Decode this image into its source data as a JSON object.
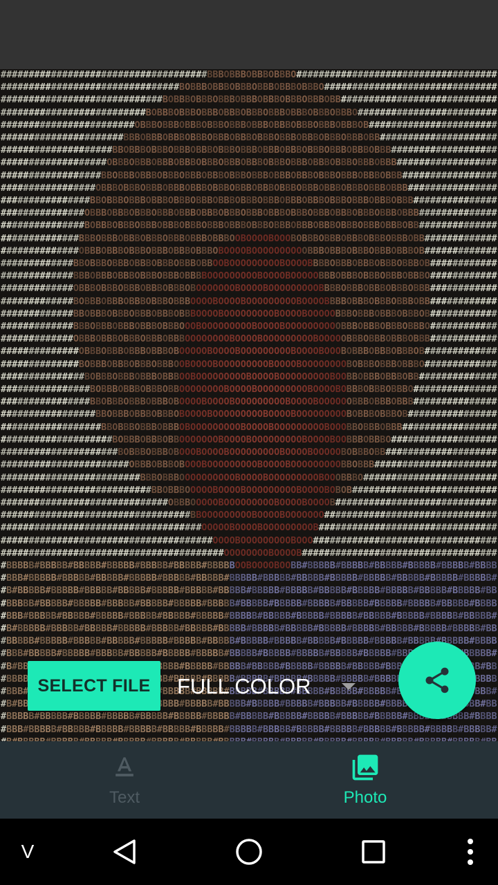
{
  "colors": {
    "accent": "#1de9b6",
    "nav_background": "#263238",
    "nav_inactive": "#4f5b62",
    "status_bar": "#333333",
    "system_nav": "#000000"
  },
  "controls": {
    "select_file_label": "SELECT FILE",
    "mode_selected": "FULL COLOR",
    "share_icon": "share-icon",
    "dropdown_icon": "dropdown-arrow-icon"
  },
  "bottom_nav": {
    "tabs": [
      {
        "label": "Text",
        "icon": "text-format-icon",
        "active": false
      },
      {
        "label": "Photo",
        "icon": "photo-library-icon",
        "active": true
      }
    ]
  },
  "system_nav": {
    "left_label": "V",
    "buttons": [
      "back-icon",
      "home-icon",
      "recents-icon",
      "overflow-menu-icon"
    ]
  }
}
